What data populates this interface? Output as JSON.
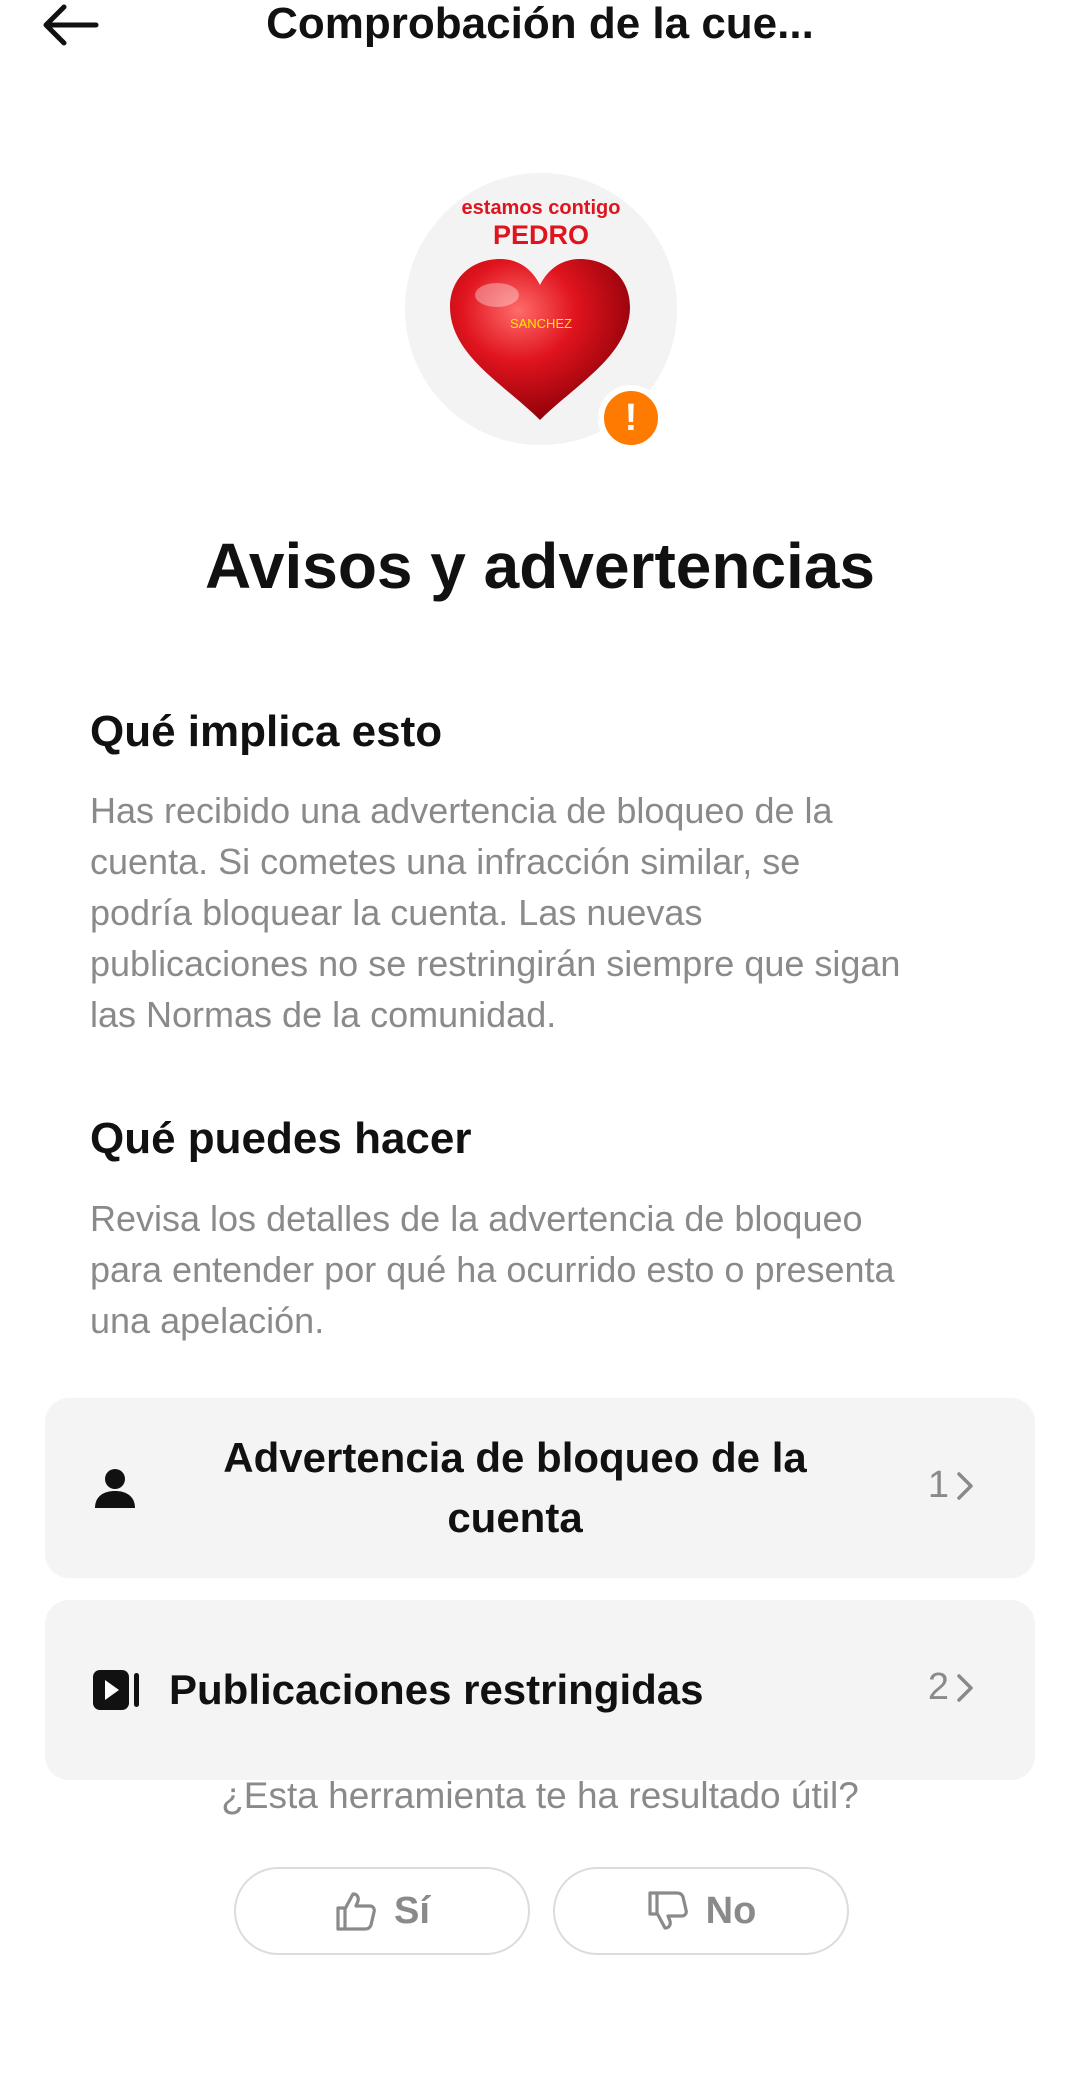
{
  "header": {
    "back_icon": "arrow-left-icon",
    "title": "Comprobación de la cue..."
  },
  "avatar": {
    "line1": "estamos contigo",
    "line2": "PEDRO",
    "line3": "SANCHEZ",
    "badge_icon": "exclamation-icon",
    "badge_symbol": "!",
    "badge_color": "#ff7a00",
    "heart_color": "#e0141e"
  },
  "main_title": "Avisos y advertencias",
  "sections": [
    {
      "title": "Qué implica esto",
      "lines": [
        "Has recibido una advertencia de bloqueo de la",
        "cuenta. Si cometes una infracción similar, se",
        "podría bloquear la cuenta. Las nuevas",
        "publicaciones no se restringirán siempre que sigan",
        "las Normas de la comunidad."
      ]
    },
    {
      "title": "Qué puedes hacer",
      "lines": [
        "Revisa los detalles de la advertencia de bloqueo",
        "para entender por qué ha ocurrido esto o presenta",
        "una apelación."
      ]
    }
  ],
  "cards": [
    {
      "icon": "person-icon",
      "label_line1": "Advertencia de bloqueo de la",
      "label_line2": "cuenta",
      "count": "1"
    },
    {
      "icon": "video-play-icon",
      "label": "Publicaciones restringidas",
      "count": "2"
    }
  ],
  "feedback": {
    "question": "¿Esta herramienta te ha resultado útil?",
    "yes_icon": "thumbs-up-icon",
    "yes_label": "Sí",
    "no_icon": "thumbs-down-icon",
    "no_label": "No"
  }
}
